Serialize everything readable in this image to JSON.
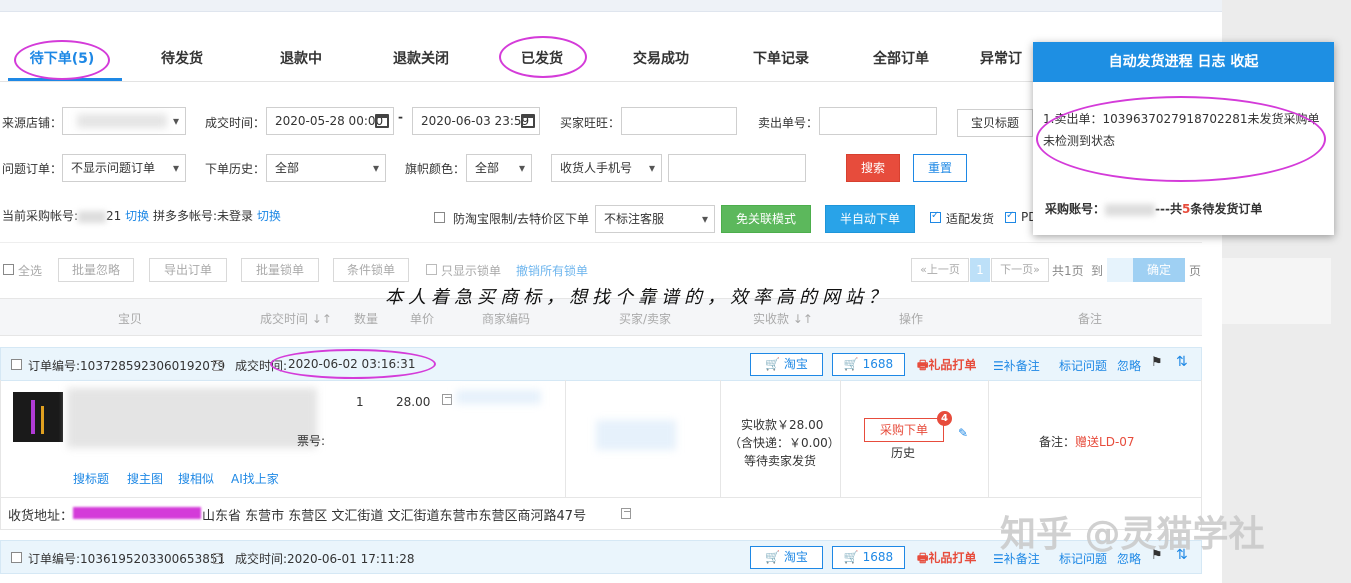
{
  "tabs": [
    {
      "label": "待下单(5)",
      "active": true
    },
    {
      "label": "待发货"
    },
    {
      "label": "退款中"
    },
    {
      "label": "退款关闭"
    },
    {
      "label": "已发货"
    },
    {
      "label": "交易成功"
    },
    {
      "label": "下单记录"
    },
    {
      "label": "全部订单"
    },
    {
      "label": "异常订"
    }
  ],
  "filters": {
    "source_shop_label": "来源店铺：",
    "deal_time_label": "成交时间：",
    "start_time": "2020-05-28 00:00",
    "dash": "-",
    "end_time": "2020-06-03 23:59",
    "buyer_ww_label": "买家旺旺：",
    "seller_no_label": "卖出单号：",
    "item_title": "宝贝标题",
    "problem_label": "问题订单：",
    "problem_value": "不显示问题订单",
    "history_label": "下单历史：",
    "history_value": "全部",
    "flag_label": "旗帜颜色：",
    "flag_value": "全部",
    "phone_select": "收货人手机号",
    "search_btn": "搜索",
    "reset_btn": "重置"
  },
  "account_bar": {
    "current_text": "当前采购帐号:",
    "suffix": "21",
    "switch1": "切换",
    "pdd_text": "拼多多帐号:未登录",
    "switch2": "切换",
    "anti_label": "防淘宝限制/去特价区下单",
    "cs_select": "不标注客服",
    "free_btn": "免关联模式",
    "semi_btn": "半自动下单",
    "adapt_label": "适配发货",
    "pd_label": "PD"
  },
  "toolbar": {
    "select_all": "全选",
    "batch_ignore": "批量忽略",
    "export": "导出订单",
    "batch_lock": "批量锁单",
    "cond_lock": "条件锁单",
    "show_lock": "只显示锁单",
    "unlock_all": "撤销所有锁单",
    "prev": "«上一页",
    "page_current": "1",
    "next": "下一页»",
    "total_pages": "共1页",
    "goto": "到",
    "confirm": "确定",
    "page_suffix": "页"
  },
  "table_headers": [
    "宝贝",
    "成交时间 ↓↑",
    "数量",
    "单价",
    "商家编码",
    "买家/卖家",
    "实收款 ↓↑",
    "操作",
    "备注"
  ],
  "order1": {
    "order_no": "订单编号:1037285923060192079",
    "deal_time_label": "成交时间:",
    "deal_time": "2020-06-02 03:16:31",
    "taobao_btn": "淘宝",
    "b1688_btn": "1688",
    "gift_print": "礼品打单",
    "add_remark": "补备注",
    "mark_problem": "标记问题",
    "ignore": "忽略",
    "qty": "1",
    "price": "28.00",
    "ticket_label": "票号:",
    "link1": "搜标题",
    "link2": "搜主图",
    "link3": "搜相似",
    "link4": "AI找上家",
    "received": "实收款￥28.00",
    "shipping": "（含快递：￥0.00）",
    "status": "等待卖家发货",
    "purchase_btn": "采购下单",
    "badge": "4",
    "history": "历史",
    "remark_label": "备注：",
    "remark_value": "赠送LD-07",
    "address_label": "收货地址：",
    "address": "山东省 东营市 东营区 文汇街道 文汇街道东营市东营区商河路47号"
  },
  "order2": {
    "order_no": "订单编号:1036195203300653851",
    "deal_time": "成交时间:2020-06-01 17:11:28",
    "taobao_btn": "淘宝",
    "b1688_btn": "1688",
    "gift_print": "礼品打单",
    "add_remark": "补备注",
    "mark_problem": "标记问题",
    "ignore": "忽略"
  },
  "popup": {
    "title": "自动发货进程 日志 收起",
    "message": "1.卖出单：1039637027918702281未发货采购单未检测到状态",
    "account_label": "采购账号：",
    "account_mid": "---共",
    "pending_count": "5",
    "account_tail": "条待发货订单"
  },
  "annotation": "本人着急买商标，想找个靠谱的，效率高的网站？",
  "watermark": "知乎 @灵猫学社",
  "colors": {
    "accent": "#1e88e5",
    "danger": "#e74c3c",
    "highlight": "#d43bd9",
    "popup_header": "#1e8fe3"
  }
}
